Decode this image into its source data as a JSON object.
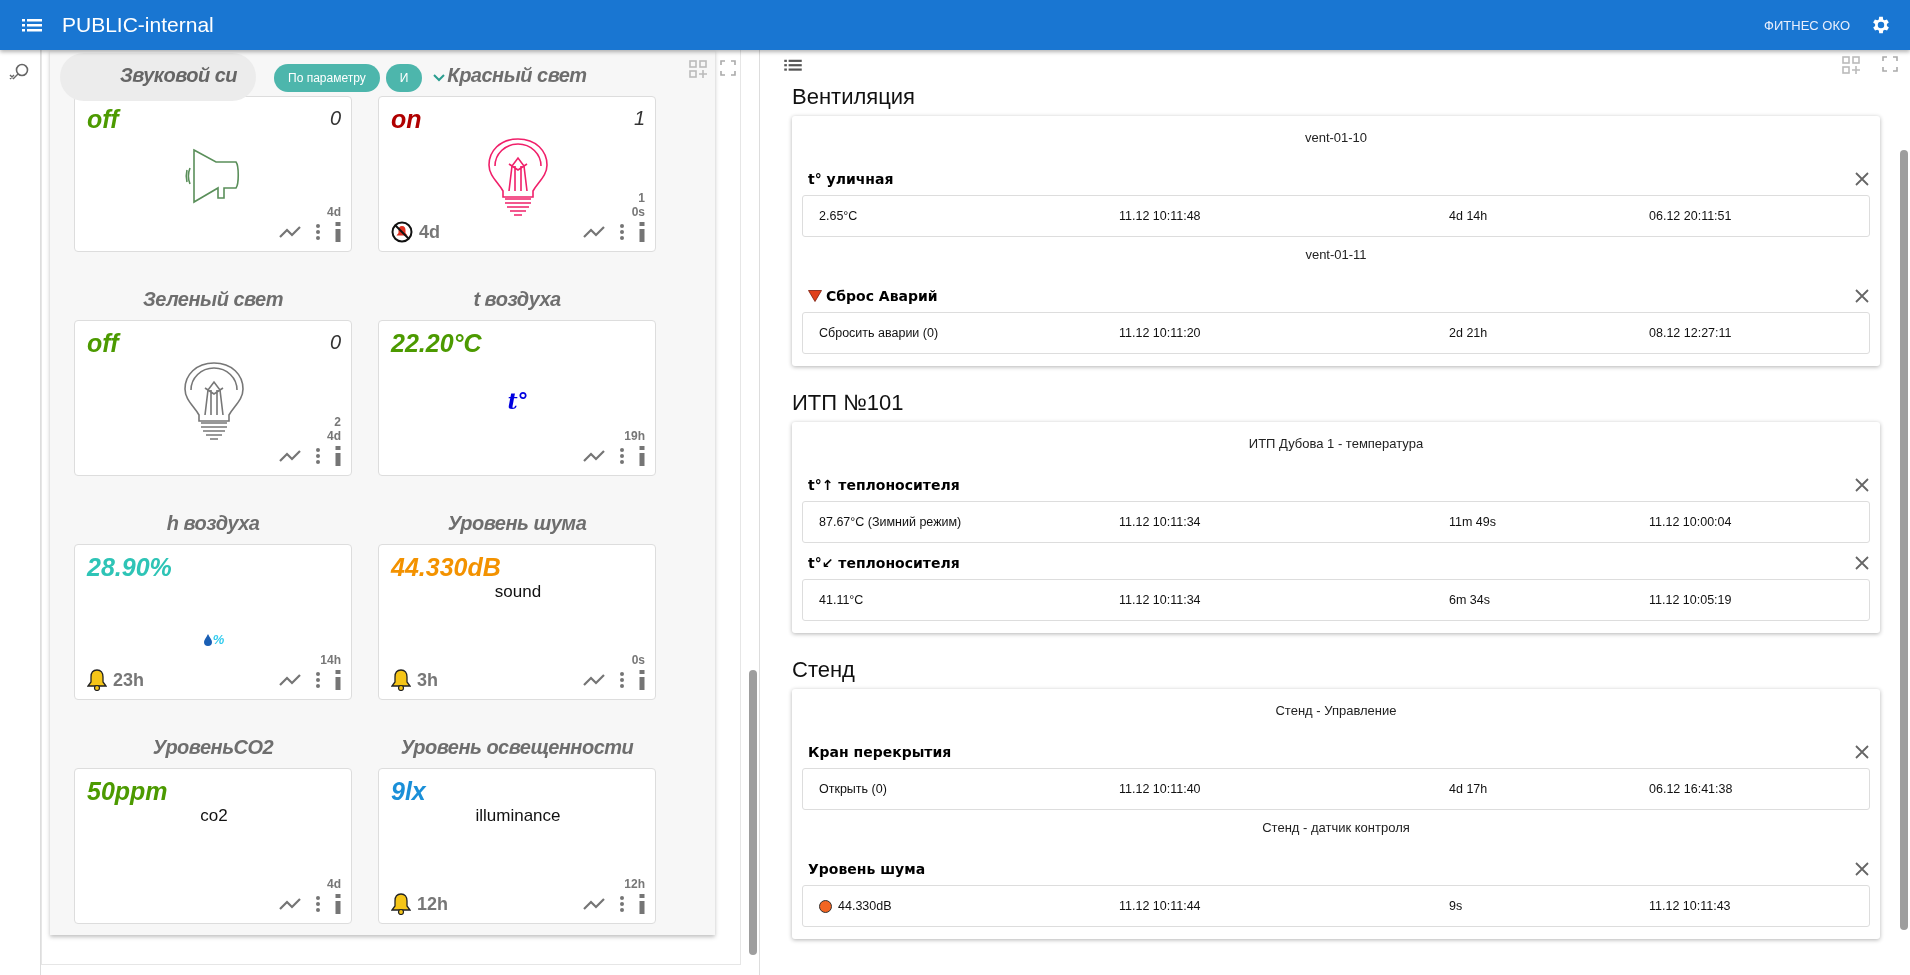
{
  "header": {
    "title": "PUBLIC-internal",
    "user": "ФИТНЕС ОКО"
  },
  "filter": {
    "chips": [
      {
        "label": "По параметру"
      },
      {
        "label": "И"
      }
    ]
  },
  "tiles": [
    {
      "title": "Звуковой си",
      "value": "off",
      "color": "#4c9a00",
      "count": "0",
      "kind": "horn",
      "stats": [
        "4d"
      ]
    },
    {
      "title": "Красный свет",
      "value": "on",
      "color": "#b00000",
      "count": "1",
      "kind": "bulb",
      "lit": true,
      "stats": [
        "1",
        "0s"
      ],
      "alarm": {
        "kind": "muted",
        "text": "4d"
      }
    },
    {
      "title": "Зеленый свет",
      "value": "off",
      "color": "#4c9a00",
      "count": "0",
      "kind": "bulb",
      "lit": false,
      "stats": [
        "2",
        "4d"
      ]
    },
    {
      "title": "t воздуха",
      "value": "22.20°C",
      "color": "#4c9a00",
      "kind": "symbol",
      "symbol": "t°",
      "stats": [
        "19h"
      ]
    },
    {
      "title": "h воздуха",
      "value": "28.90%",
      "color": "#2ec4b6",
      "kind": "humidity",
      "symbol": "%",
      "stats": [
        "14h"
      ],
      "alarm": {
        "kind": "bell",
        "text": "23h"
      }
    },
    {
      "title": "Уровень шума",
      "value": "44.330dB",
      "color": "#f39200",
      "kind": "label",
      "label": "sound",
      "stats": [
        "0s"
      ],
      "alarm": {
        "kind": "bell",
        "text": "3h"
      }
    },
    {
      "title": "УровеньCO2",
      "value": "50ppm",
      "color": "#4c9a00",
      "kind": "label",
      "label": "co2",
      "stats": [
        "4d"
      ]
    },
    {
      "title": "Уровень освещенности",
      "value": "9lx",
      "color": "#1a8fd8",
      "kind": "label",
      "label": "illuminance",
      "stats": [
        "12h"
      ],
      "alarm": {
        "kind": "bell",
        "text": "12h"
      }
    }
  ],
  "sections": [
    {
      "title": "Вентиляция",
      "groups": [
        {
          "title": "vent-01-10",
          "items": [
            {
              "title": "t° уличная",
              "cells": [
                "2.65°C",
                "11.12 10:11:48",
                "4d 14h",
                "06.12 20:11:51"
              ]
            }
          ]
        },
        {
          "title": "vent-01-11",
          "items": [
            {
              "title": "Сброс Аварий",
              "kind": "alarm",
              "cells": [
                "Сбросить аварии (0)",
                "11.12 10:11:20",
                "2d 21h",
                "08.12 12:27:11"
              ]
            }
          ]
        }
      ]
    },
    {
      "title": "ИТП №101",
      "groups": [
        {
          "title": "ИТП Дубова 1 - температура",
          "items": [
            {
              "title": "t°↑ теплоносителя",
              "cells": [
                "87.67°C (Зимний режим)",
                "11.12 10:11:34",
                "11m 49s",
                "11.12 10:00:04"
              ]
            },
            {
              "title": "t°↙ теплоносителя",
              "cells": [
                "41.11°C",
                "11.12 10:11:34",
                "6m 34s",
                "11.12 10:05:19"
              ]
            }
          ]
        }
      ]
    },
    {
      "title": "Стенд",
      "groups": [
        {
          "title": "Стенд - Управление",
          "items": [
            {
              "title": "Кран перекрытия",
              "cells": [
                "Открыть (0)",
                "11.12 10:11:40",
                "4d 17h",
                "06.12 16:41:38"
              ]
            }
          ]
        },
        {
          "title": "Стенд - датчик контроля",
          "items": [
            {
              "title": "Уровень шума",
              "color": "#f26522",
              "cells": [
                "44.330dB",
                "11.12 10:11:44",
                "9s",
                "11.12 10:11:43"
              ]
            }
          ]
        }
      ]
    }
  ]
}
